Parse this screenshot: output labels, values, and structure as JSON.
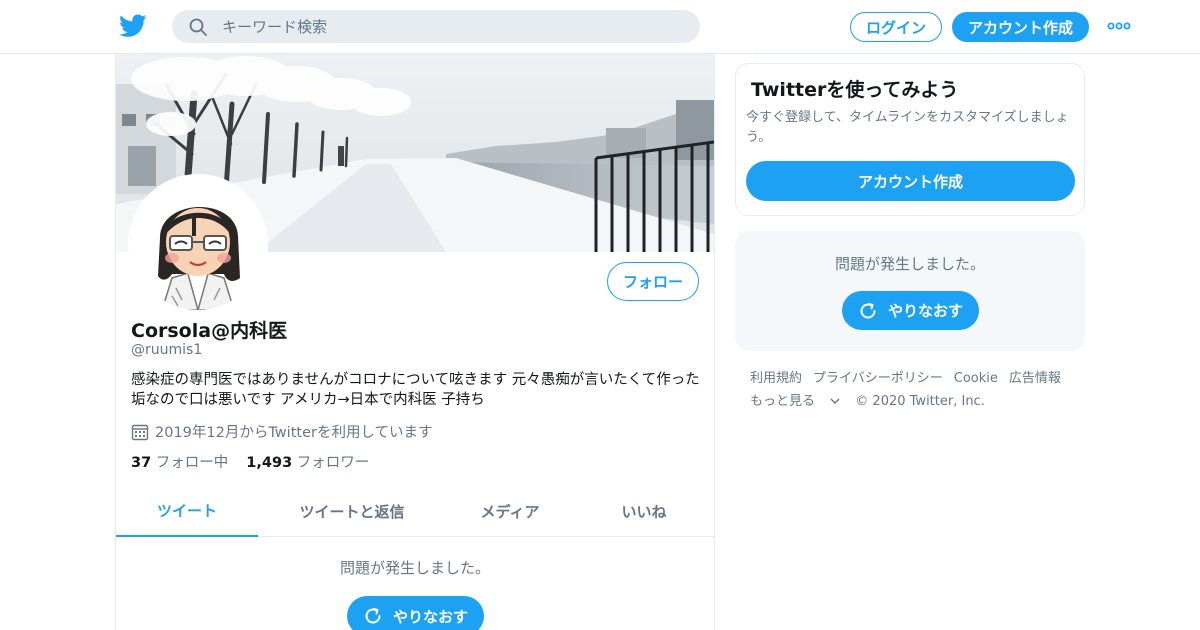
{
  "header": {
    "logo_icon": "twitter-bird-icon",
    "search": {
      "placeholder": "キーワード検索",
      "icon": "search-icon"
    },
    "login_label": "ログイン",
    "signup_label": "アカウント作成",
    "more_icon": "more-dots-icon"
  },
  "profile": {
    "name": "Corsola@内科医",
    "handle": "@ruumis1",
    "bio": "感染症の専門医ではありませんがコロナについて呟きます 元々愚痴が言いたくて作った垢なので口は悪いです アメリカ→日本で内科医 子持ち",
    "joined": "2019年12月からTwitterを利用しています",
    "following_count": "37",
    "following_label": "フォロー中",
    "followers_count": "1,493",
    "followers_label": "フォロワー",
    "follow_button": "フォロー"
  },
  "tabs": [
    {
      "label": "ツイート",
      "active": true
    },
    {
      "label": "ツイートと返信",
      "active": false
    },
    {
      "label": "メディア",
      "active": false
    },
    {
      "label": "いいね",
      "active": false
    }
  ],
  "timeline": {
    "error_message": "問題が発生しました。",
    "retry_label": "やりなおす"
  },
  "sidebar": {
    "signup_card": {
      "title": "Twitterを使ってみよう",
      "description": "今すぐ登録して、タイムラインをカスタマイズしましょう。",
      "button_label": "アカウント作成"
    },
    "error_card": {
      "message": "問題が発生しました。",
      "retry_label": "やりなおす"
    },
    "footer_links": [
      "利用規約",
      "プライバシーポリシー",
      "Cookie",
      "広告情報"
    ],
    "footer_more": "もっと見る",
    "copyright": "© 2020 Twitter, Inc."
  },
  "colors": {
    "accent": "#1da1f2",
    "secondary_text": "#657786",
    "border": "#e6ecf0"
  }
}
